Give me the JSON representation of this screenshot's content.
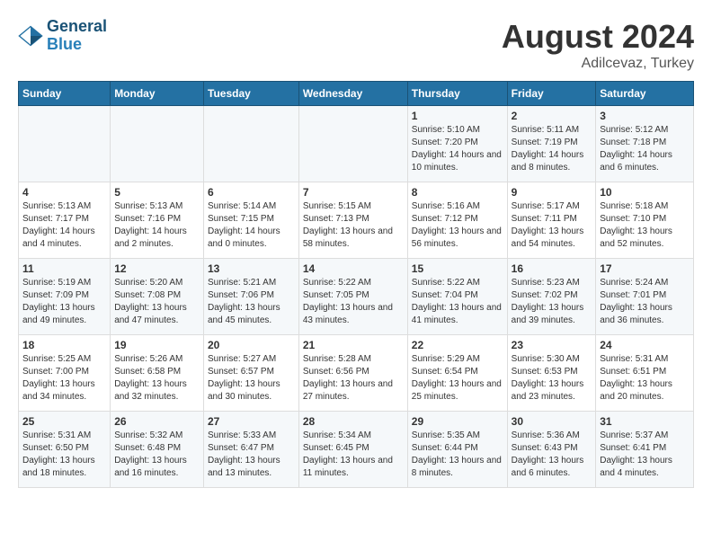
{
  "header": {
    "logo_line1": "General",
    "logo_line2": "Blue",
    "month_year": "August 2024",
    "location": "Adilcevaz, Turkey"
  },
  "weekdays": [
    "Sunday",
    "Monday",
    "Tuesday",
    "Wednesday",
    "Thursday",
    "Friday",
    "Saturday"
  ],
  "weeks": [
    [
      {
        "day": "",
        "info": ""
      },
      {
        "day": "",
        "info": ""
      },
      {
        "day": "",
        "info": ""
      },
      {
        "day": "",
        "info": ""
      },
      {
        "day": "1",
        "info": "Sunrise: 5:10 AM\nSunset: 7:20 PM\nDaylight: 14 hours\nand 10 minutes."
      },
      {
        "day": "2",
        "info": "Sunrise: 5:11 AM\nSunset: 7:19 PM\nDaylight: 14 hours\nand 8 minutes."
      },
      {
        "day": "3",
        "info": "Sunrise: 5:12 AM\nSunset: 7:18 PM\nDaylight: 14 hours\nand 6 minutes."
      }
    ],
    [
      {
        "day": "4",
        "info": "Sunrise: 5:13 AM\nSunset: 7:17 PM\nDaylight: 14 hours\nand 4 minutes."
      },
      {
        "day": "5",
        "info": "Sunrise: 5:13 AM\nSunset: 7:16 PM\nDaylight: 14 hours\nand 2 minutes."
      },
      {
        "day": "6",
        "info": "Sunrise: 5:14 AM\nSunset: 7:15 PM\nDaylight: 14 hours\nand 0 minutes."
      },
      {
        "day": "7",
        "info": "Sunrise: 5:15 AM\nSunset: 7:13 PM\nDaylight: 13 hours\nand 58 minutes."
      },
      {
        "day": "8",
        "info": "Sunrise: 5:16 AM\nSunset: 7:12 PM\nDaylight: 13 hours\nand 56 minutes."
      },
      {
        "day": "9",
        "info": "Sunrise: 5:17 AM\nSunset: 7:11 PM\nDaylight: 13 hours\nand 54 minutes."
      },
      {
        "day": "10",
        "info": "Sunrise: 5:18 AM\nSunset: 7:10 PM\nDaylight: 13 hours\nand 52 minutes."
      }
    ],
    [
      {
        "day": "11",
        "info": "Sunrise: 5:19 AM\nSunset: 7:09 PM\nDaylight: 13 hours\nand 49 minutes."
      },
      {
        "day": "12",
        "info": "Sunrise: 5:20 AM\nSunset: 7:08 PM\nDaylight: 13 hours\nand 47 minutes."
      },
      {
        "day": "13",
        "info": "Sunrise: 5:21 AM\nSunset: 7:06 PM\nDaylight: 13 hours\nand 45 minutes."
      },
      {
        "day": "14",
        "info": "Sunrise: 5:22 AM\nSunset: 7:05 PM\nDaylight: 13 hours\nand 43 minutes."
      },
      {
        "day": "15",
        "info": "Sunrise: 5:22 AM\nSunset: 7:04 PM\nDaylight: 13 hours\nand 41 minutes."
      },
      {
        "day": "16",
        "info": "Sunrise: 5:23 AM\nSunset: 7:02 PM\nDaylight: 13 hours\nand 39 minutes."
      },
      {
        "day": "17",
        "info": "Sunrise: 5:24 AM\nSunset: 7:01 PM\nDaylight: 13 hours\nand 36 minutes."
      }
    ],
    [
      {
        "day": "18",
        "info": "Sunrise: 5:25 AM\nSunset: 7:00 PM\nDaylight: 13 hours\nand 34 minutes."
      },
      {
        "day": "19",
        "info": "Sunrise: 5:26 AM\nSunset: 6:58 PM\nDaylight: 13 hours\nand 32 minutes."
      },
      {
        "day": "20",
        "info": "Sunrise: 5:27 AM\nSunset: 6:57 PM\nDaylight: 13 hours\nand 30 minutes."
      },
      {
        "day": "21",
        "info": "Sunrise: 5:28 AM\nSunset: 6:56 PM\nDaylight: 13 hours\nand 27 minutes."
      },
      {
        "day": "22",
        "info": "Sunrise: 5:29 AM\nSunset: 6:54 PM\nDaylight: 13 hours\nand 25 minutes."
      },
      {
        "day": "23",
        "info": "Sunrise: 5:30 AM\nSunset: 6:53 PM\nDaylight: 13 hours\nand 23 minutes."
      },
      {
        "day": "24",
        "info": "Sunrise: 5:31 AM\nSunset: 6:51 PM\nDaylight: 13 hours\nand 20 minutes."
      }
    ],
    [
      {
        "day": "25",
        "info": "Sunrise: 5:31 AM\nSunset: 6:50 PM\nDaylight: 13 hours\nand 18 minutes."
      },
      {
        "day": "26",
        "info": "Sunrise: 5:32 AM\nSunset: 6:48 PM\nDaylight: 13 hours\nand 16 minutes."
      },
      {
        "day": "27",
        "info": "Sunrise: 5:33 AM\nSunset: 6:47 PM\nDaylight: 13 hours\nand 13 minutes."
      },
      {
        "day": "28",
        "info": "Sunrise: 5:34 AM\nSunset: 6:45 PM\nDaylight: 13 hours\nand 11 minutes."
      },
      {
        "day": "29",
        "info": "Sunrise: 5:35 AM\nSunset: 6:44 PM\nDaylight: 13 hours\nand 8 minutes."
      },
      {
        "day": "30",
        "info": "Sunrise: 5:36 AM\nSunset: 6:43 PM\nDaylight: 13 hours\nand 6 minutes."
      },
      {
        "day": "31",
        "info": "Sunrise: 5:37 AM\nSunset: 6:41 PM\nDaylight: 13 hours\nand 4 minutes."
      }
    ]
  ]
}
